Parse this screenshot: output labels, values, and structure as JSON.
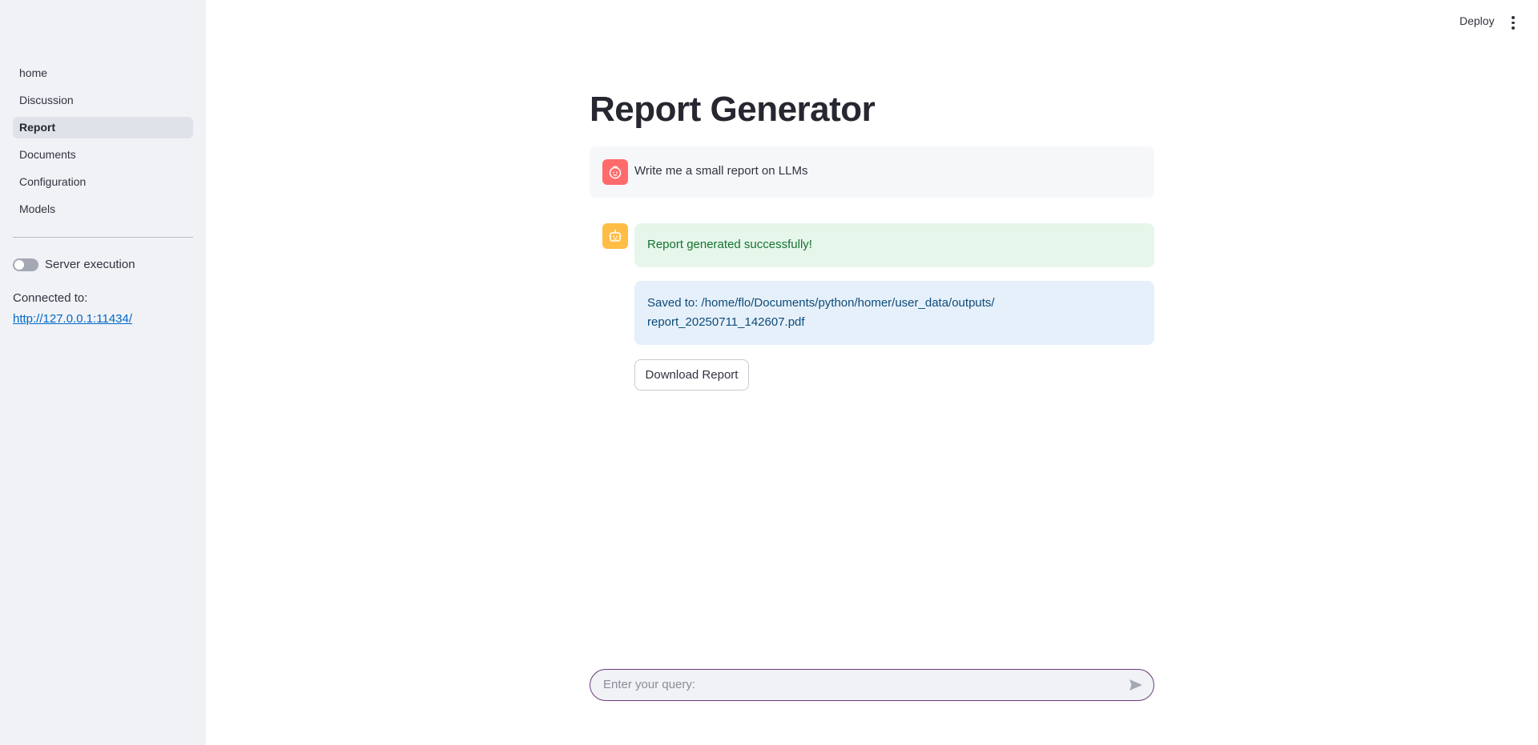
{
  "sidebar": {
    "nav": [
      {
        "label": "home"
      },
      {
        "label": "Discussion"
      },
      {
        "label": "Report",
        "active": true
      },
      {
        "label": "Documents"
      },
      {
        "label": "Configuration"
      },
      {
        "label": "Models"
      }
    ],
    "server_toggle": {
      "label": "Server execution",
      "on": false
    },
    "connected_label": "Connected to:",
    "connected_url": "http://127.0.0.1:11434/"
  },
  "header": {
    "deploy_label": "Deploy",
    "menu_icon": "more-vertical-icon"
  },
  "main": {
    "title": "Report Generator",
    "user_message": {
      "avatar_icon": "user-face-icon",
      "text": "Write me a small report on LLMs"
    },
    "assistant": {
      "avatar_icon": "robot-icon",
      "success_text": "Report generated successfully!",
      "info_line1": "Saved to: /home/flo/Documents/python/homer/user_data/outputs/",
      "info_line2": "report_20250711_142607.pdf",
      "download_label": "Download Report"
    }
  },
  "chat_input": {
    "placeholder": "Enter your query:",
    "value": "",
    "send_icon": "send-icon"
  },
  "colors": {
    "sidebar_bg": "#f0f2f6",
    "active_nav_bg": "#dfe2e9",
    "user_avatar": "#ff6b6b",
    "bot_avatar": "#ffbd45",
    "success_bg": "#e6f6ea",
    "success_text": "#177233",
    "info_bg": "#e6f0fa",
    "info_text": "#0d4b7a",
    "input_border": "#6b3a78",
    "link": "#0068c9"
  }
}
